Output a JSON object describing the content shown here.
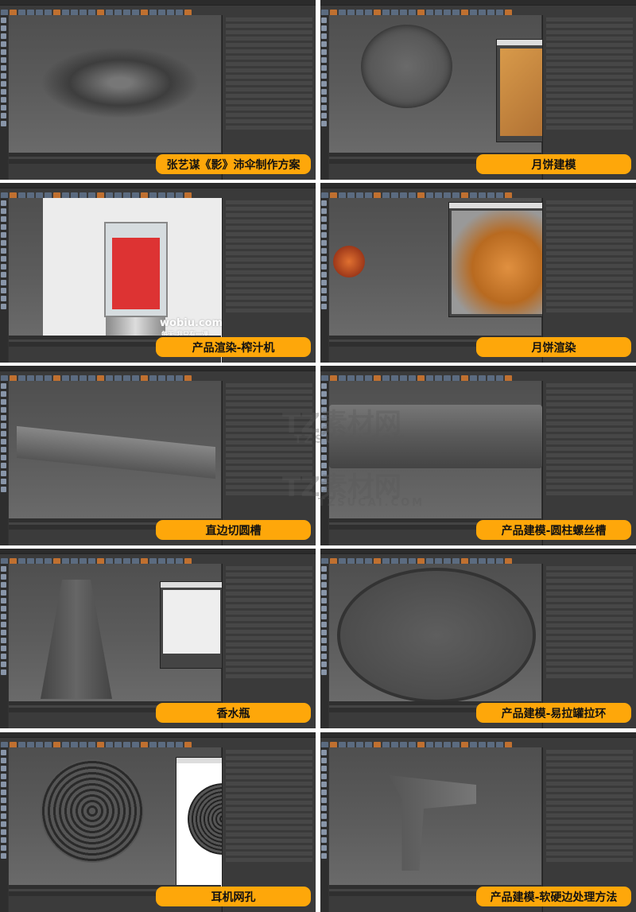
{
  "tiles": [
    {
      "label": "张艺谋《影》沛伞制作方案",
      "subject": "umbrella-model"
    },
    {
      "label": "月饼建模",
      "subject": "mooncake-model"
    },
    {
      "label": "产品渲染-榨汁机",
      "subject": "blender-render"
    },
    {
      "label": "月饼渲染",
      "subject": "mooncake-render"
    },
    {
      "label": "直边切圆槽",
      "subject": "twisted-bar"
    },
    {
      "label": "产品建模-圆柱螺丝槽",
      "subject": "cylinder-grooves"
    },
    {
      "label": "香水瓶",
      "subject": "perfume-bottle"
    },
    {
      "label": "产品建模-易拉罐拉环",
      "subject": "can-pull-tab"
    },
    {
      "label": "耳机网孔",
      "subject": "earphone-mesh"
    },
    {
      "label": "产品建模-软硬边处理方法",
      "subject": "faucet-model"
    }
  ],
  "watermarks": {
    "wobiu": "wobiu.com",
    "wobiu_sub": "每天,我只有一课",
    "tz": "TZ素材网",
    "tz_url": "TZSUCAI.COM"
  },
  "colors": {
    "label_bg": "#fea70a",
    "ui_bg": "#333333",
    "accent": "#5b6b80"
  }
}
